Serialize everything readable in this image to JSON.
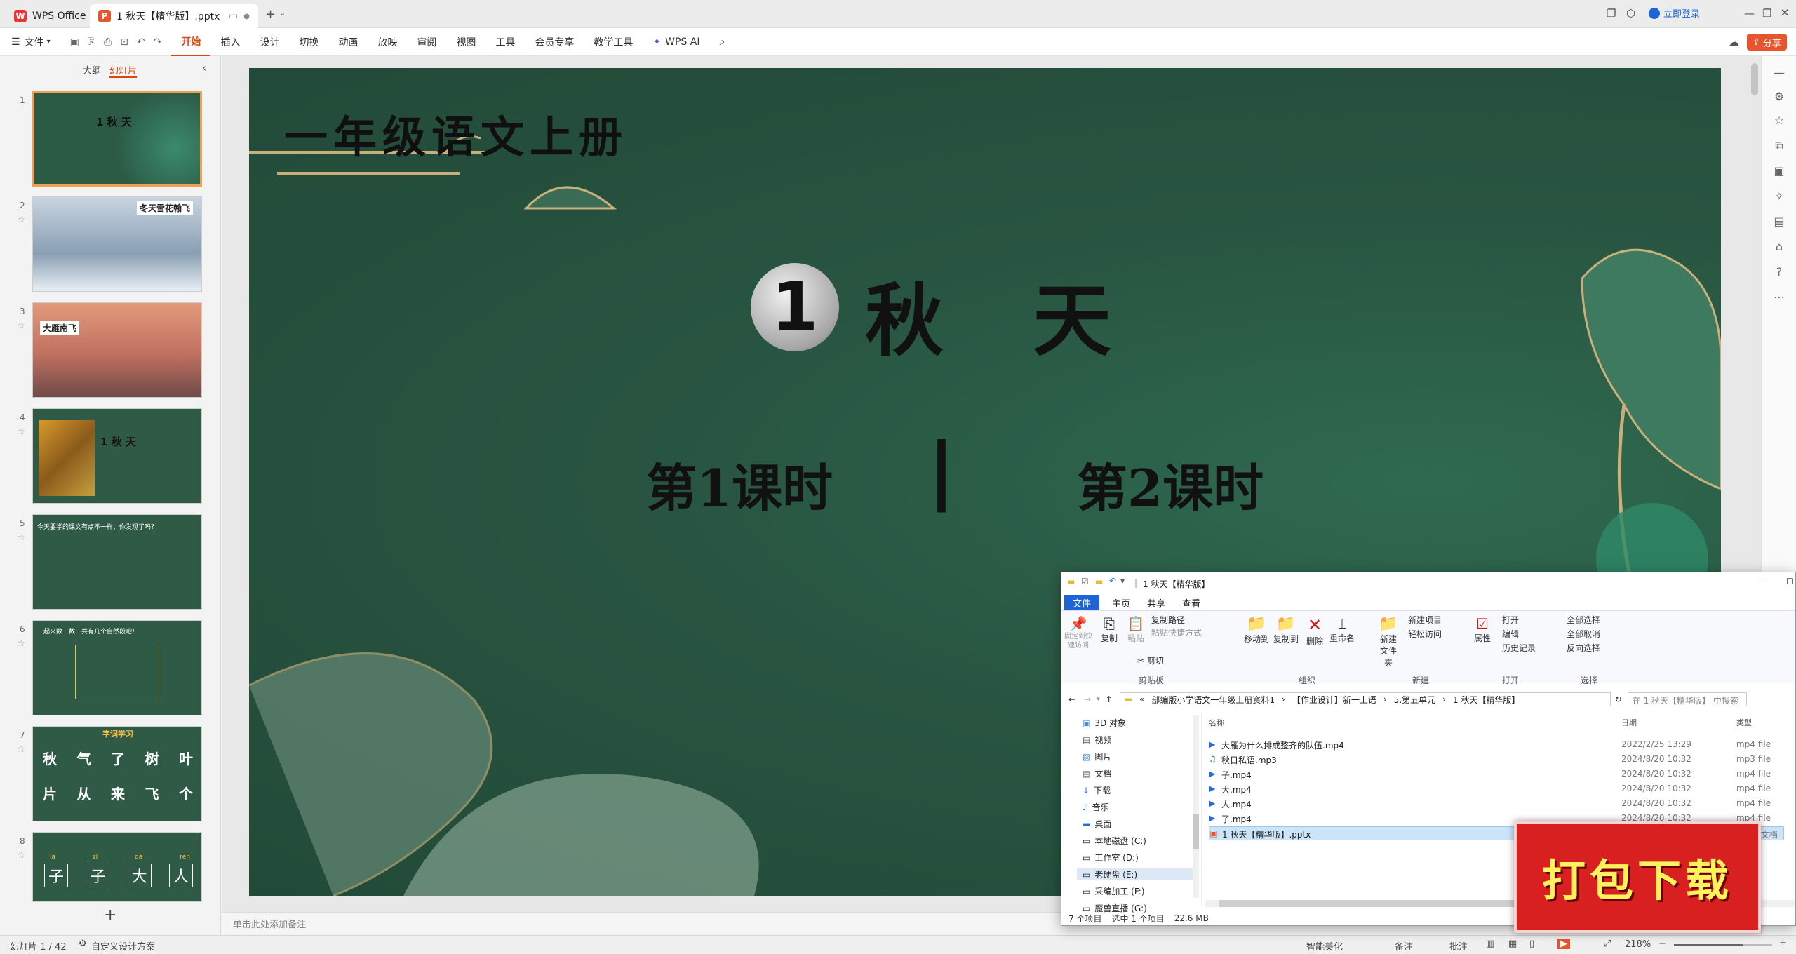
{
  "titlebar": {
    "home_tab": "WPS Office",
    "doc_tab": "1 秋天【精华版】.pptx",
    "login": "立即登录"
  },
  "menu": {
    "file": "文件",
    "items": [
      "开始",
      "插入",
      "设计",
      "切换",
      "动画",
      "放映",
      "审阅",
      "视图",
      "工具",
      "会员专享",
      "教学工具"
    ],
    "wps_ai": "WPS AI",
    "share": "分享"
  },
  "sidebar": {
    "tab_outline": "大纲",
    "tab_slides": "幻灯片",
    "slides": [
      {
        "num": "1",
        "caption": "1 秋 天"
      },
      {
        "num": "2",
        "caption": "冬天雪花翰飞"
      },
      {
        "num": "3",
        "caption": "大雁南飞"
      },
      {
        "num": "4",
        "caption": "1 秋 天"
      },
      {
        "num": "5",
        "caption": "今天要学的课文有点不一样，你发现了吗？"
      },
      {
        "num": "6",
        "caption": "一起来数一数一共有几个自然段吧！"
      },
      {
        "num": "7",
        "caption": "字词学习"
      },
      {
        "num": "8",
        "caption": ""
      }
    ],
    "slide7": {
      "row1": [
        "秋",
        "气",
        "了",
        "树",
        "叶"
      ],
      "row2": [
        "片",
        "从",
        "来",
        "飞",
        "个"
      ]
    },
    "slide8": {
      "pinyin": [
        "là",
        "zǐ",
        "dà",
        "rén"
      ],
      "chars": [
        "子",
        "子",
        "大",
        "人"
      ]
    },
    "add": "+"
  },
  "slide": {
    "top_title": "一年级语文上册",
    "lesson_number": "1",
    "lesson_name": "秋 天",
    "period1": "第1课时",
    "divider": "|",
    "period2": "第2课时"
  },
  "notes_placeholder": "单击此处添加备注",
  "status": {
    "slide_count": "幻灯片 1 / 42",
    "design": "自定义设计方案",
    "beautify": "智能美化",
    "notes": "备注",
    "comments": "批注",
    "zoom": "218%"
  },
  "explorer": {
    "title": "1 秋天【精华版】",
    "ribbon_tabs": [
      "文件",
      "主页",
      "共享",
      "查看"
    ],
    "buttons": {
      "pin": "固定到快速访问",
      "copy": "复制",
      "paste": "粘贴",
      "copy_path": "复制路径",
      "paste_shortcut": "粘贴快捷方式",
      "cut": "剪切",
      "move_to": "移动到",
      "copy_to": "复制到",
      "delete": "删除",
      "rename": "重命名",
      "new_folder": "新建文件夹",
      "new_item": "新建项目",
      "easy_access": "轻松访问",
      "properties": "属性",
      "open": "打开",
      "edit": "编辑",
      "history": "历史记录",
      "select_all": "全部选择",
      "select_none": "全部取消",
      "invert": "反向选择"
    },
    "groups": [
      "剪贴板",
      "组织",
      "新建",
      "打开",
      "选择"
    ],
    "path": [
      "部编版小学语文一年级上册资料1",
      "【作业设计】新一上语",
      "5.第五单元",
      "1 秋天【精华版】"
    ],
    "search_placeholder": "在 1 秋天【精华版】 中搜索",
    "nav": [
      "3D 对象",
      "视频",
      "图片",
      "文档",
      "下载",
      "音乐",
      "桌面",
      "本地磁盘 (C:)",
      "工作室 (D:)",
      "老硬盘 (E:)",
      "采编加工 (F:)",
      "魔兽直播 (G:)"
    ],
    "columns": {
      "name": "名称",
      "date": "日期",
      "type": "类型"
    },
    "files": [
      {
        "name": "大雁为什么排成整齐的队伍.mp4",
        "date": "2022/2/25 13:29",
        "type": "mp4 file"
      },
      {
        "name": "秋日私语.mp3",
        "date": "2024/8/20 10:32",
        "type": "mp3 file"
      },
      {
        "name": "子.mp4",
        "date": "2024/8/20 10:32",
        "type": "mp4 file"
      },
      {
        "name": "大.mp4",
        "date": "2024/8/20 10:32",
        "type": "mp4 file"
      },
      {
        "name": "人.mp4",
        "date": "2024/8/20 10:32",
        "type": "mp4 file"
      },
      {
        "name": "了.mp4",
        "date": "2024/8/20 10:32",
        "type": "mp4 file"
      },
      {
        "name": "1 秋天【精华版】.pptx",
        "date": "",
        "type": "PPTX 文档"
      }
    ],
    "status_items": "7 个项目",
    "status_selected": "选中 1 个项目",
    "status_size": "22.6 MB"
  },
  "badge": {
    "text": "打包下载"
  }
}
